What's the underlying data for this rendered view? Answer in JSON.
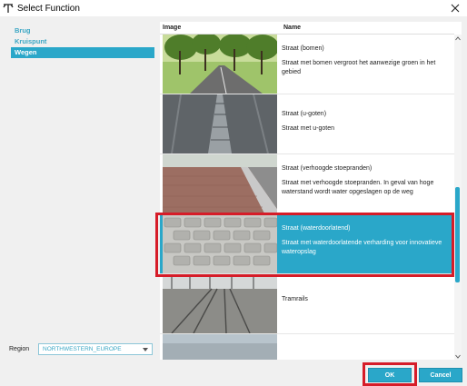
{
  "window": {
    "title": "Select Function"
  },
  "sidebar": {
    "items": [
      {
        "label": "Brug"
      },
      {
        "label": "Kruispunt"
      },
      {
        "label": "Wegen"
      }
    ],
    "selected_index": 2
  },
  "region": {
    "label": "Region",
    "value": "NORTHWESTERN_EUROPE"
  },
  "table": {
    "columns": [
      "Image",
      "Name"
    ],
    "rows": [
      {
        "name": "Straat (bomen)",
        "desc": "Straat met bomen vergroot het aanwezige groen in het gebied"
      },
      {
        "name": "Straat (u-goten)",
        "desc": "Straat met u-goten"
      },
      {
        "name": "Straat (verhoogde stoepranden)",
        "desc": "Straat met verhoogde stoepranden. In geval van hoge waterstand wordt water opgeslagen op de weg"
      },
      {
        "name": "Straat (waterdoorlatend)",
        "desc": "Straat met waterdoorlatende verharding voor innovatieve wateropslag"
      },
      {
        "name": "Tramrails",
        "desc": ""
      }
    ],
    "selected_index": 3
  },
  "buttons": {
    "ok": "OK",
    "cancel": "Cancel"
  },
  "colors": {
    "accent": "#2aa7c9",
    "highlight": "#d61c28"
  }
}
